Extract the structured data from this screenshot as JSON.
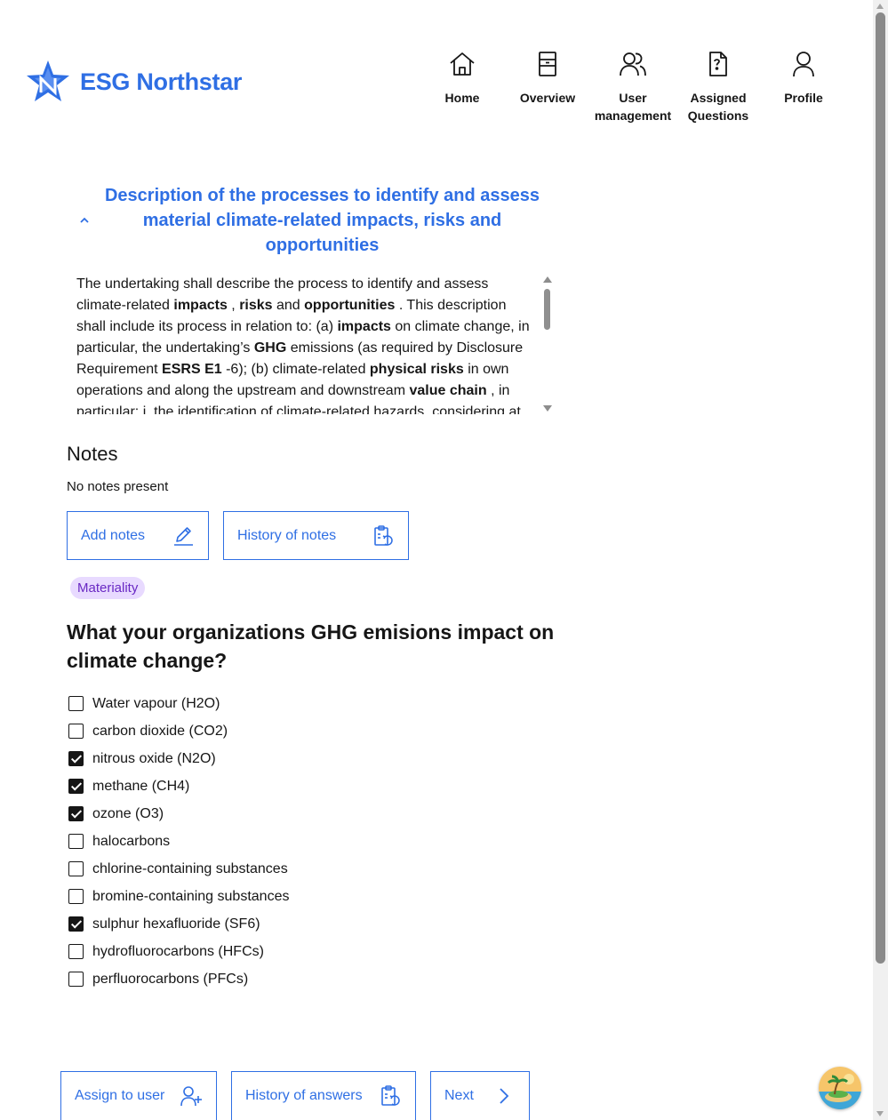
{
  "brand": {
    "name": "ESG Northstar",
    "color": "#2f6fe4"
  },
  "nav": [
    {
      "label": "Home",
      "icon": "home-icon"
    },
    {
      "label": "Overview",
      "icon": "archive-icon"
    },
    {
      "label": "User management",
      "icon": "users-icon"
    },
    {
      "label": "Assigned Questions",
      "icon": "document-question-icon"
    },
    {
      "label": "Profile",
      "icon": "user-icon"
    }
  ],
  "description": {
    "title": "Description of the processes to identify and assess material climate-related impacts, risks and opportunities",
    "body_html": "The undertaking shall describe the process to identify and assess climate-related <b>impacts</b> , <b>risks</b> and <b>opportunities</b> . This description shall include its process in relation to: (a) <b>impacts</b> on climate change, in particular, the undertaking’s <b>GHG</b> emissions (as required by Disclosure Requirement <b>ESRS E1</b> -6); (b) climate-related <b>physical risks</b> in own operations and along the upstream and downstream <b>value chain</b> , in particular: i. the identification of climate-related hazards, considering at least high emission climate scenarios; and ii. the assessment of how its assets and business activities may be exposed and are sensitive to these climate-related hazards."
  },
  "notes": {
    "title": "Notes",
    "empty_text": "No notes present",
    "add_label": "Add notes",
    "history_label": "History of notes"
  },
  "tag": "Materiality",
  "question": "What your organizations GHG emisions impact on climate change?",
  "options": [
    {
      "label": "Water vapour (H2O)",
      "checked": false
    },
    {
      "label": "carbon dioxide (CO2)",
      "checked": false
    },
    {
      "label": "nitrous oxide (N2O)",
      "checked": true
    },
    {
      "label": "methane (CH4)",
      "checked": true
    },
    {
      "label": "ozone (O3)",
      "checked": true
    },
    {
      "label": "halocarbons",
      "checked": false
    },
    {
      "label": "chlorine-containing substances",
      "checked": false
    },
    {
      "label": "bromine-containing substances",
      "checked": false
    },
    {
      "label": "sulphur hexafluoride (SF6)",
      "checked": true
    },
    {
      "label": "hydrofluorocarbons (HFCs)",
      "checked": false
    },
    {
      "label": "perfluorocarbons (PFCs)",
      "checked": false
    }
  ],
  "footer": {
    "assign_label": "Assign to user",
    "history_answers_label": "History of answers",
    "next_label": "Next"
  }
}
